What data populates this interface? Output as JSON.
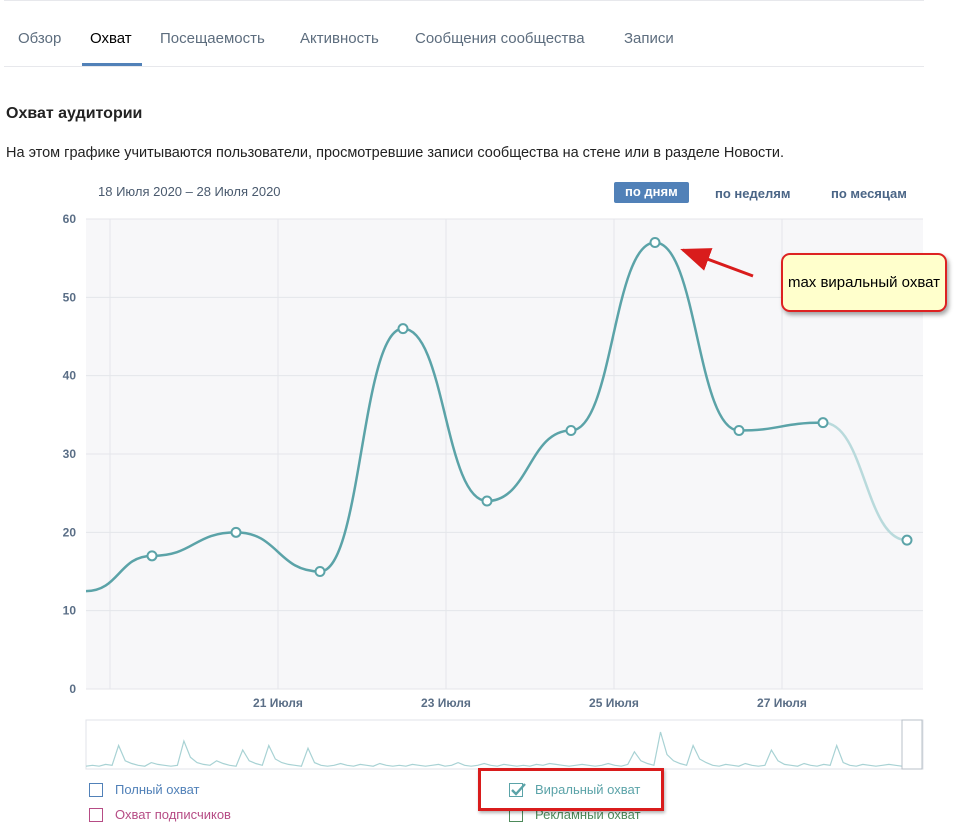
{
  "tabs": [
    {
      "label": "Обзор",
      "active": false
    },
    {
      "label": "Охват",
      "active": true
    },
    {
      "label": "Посещаемость",
      "active": false
    },
    {
      "label": "Активность",
      "active": false
    },
    {
      "label": "Сообщения сообщества",
      "active": false
    },
    {
      "label": "Записи",
      "active": false
    }
  ],
  "section": {
    "title": "Охват аудитории",
    "description": "На этом графике учитываются пользователи, просмотревшие записи сообщества на стене или в разделе Новости."
  },
  "date_range": "18 Июля 2020 – 28 Июля 2020",
  "period_options": [
    {
      "label": "по дням",
      "active": true
    },
    {
      "label": "по неделям",
      "active": false
    },
    {
      "label": "по месяцам",
      "active": false
    }
  ],
  "annotation": {
    "text": "max виральный охват",
    "border_color": "#dd2222",
    "fill": "#ffffcc"
  },
  "chart_data": {
    "type": "line",
    "series": [
      {
        "name": "Виральный охват",
        "color": "#5ba3a8",
        "x": [
          "18.07",
          "19.07",
          "20.07",
          "21.07",
          "22.07",
          "23.07",
          "24.07",
          "25.07",
          "26.07",
          "27.07",
          "28.07"
        ],
        "values": [
          null,
          17,
          20,
          15,
          46,
          24,
          33,
          57,
          33,
          34,
          19
        ]
      }
    ],
    "yticks": [
      "0",
      "10",
      "20",
      "30",
      "40",
      "50",
      "60"
    ],
    "xtick_labels": [
      "21 Июля",
      "23 Июля",
      "25 Июля",
      "27 Июля"
    ],
    "ylim": [
      0,
      60
    ],
    "grid": true
  },
  "legend": [
    {
      "label": "Полный охват",
      "checked": false,
      "color": "#5181b8"
    },
    {
      "label": "Охват подписчиков",
      "checked": false,
      "color": "#b64c85"
    },
    {
      "label": "Виральный охват",
      "checked": true,
      "color": "#5ba3a8"
    },
    {
      "label": "Рекламный охват",
      "checked": false,
      "color": "#4d8a5a"
    }
  ]
}
